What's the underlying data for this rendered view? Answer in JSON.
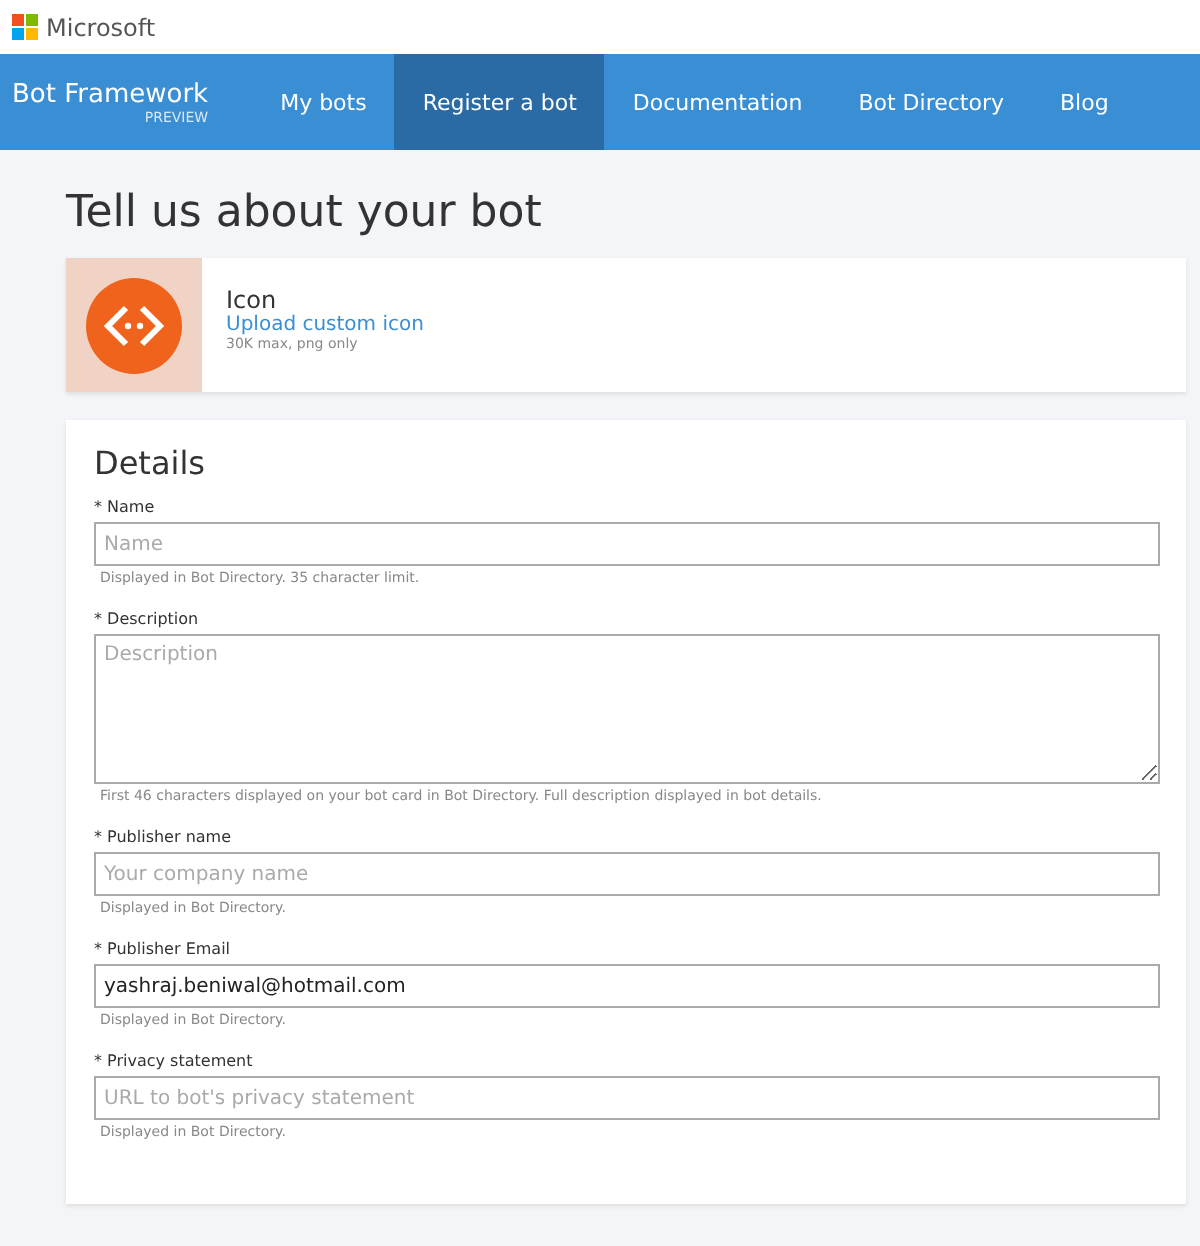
{
  "brand": {
    "name": "Microsoft"
  },
  "nav": {
    "title": "Bot Framework",
    "subtitle": "PREVIEW",
    "items": [
      {
        "label": "My bots",
        "selected": false
      },
      {
        "label": "Register a bot",
        "selected": true
      },
      {
        "label": "Documentation",
        "selected": false
      },
      {
        "label": "Bot Directory",
        "selected": false
      },
      {
        "label": "Blog",
        "selected": false
      }
    ]
  },
  "page_title": "Tell us about your bot",
  "icon_card": {
    "title": "Icon",
    "link": "Upload custom icon",
    "hint": "30K max, png only"
  },
  "details": {
    "title": "Details",
    "fields": [
      {
        "kind": "input",
        "label": "* Name",
        "placeholder": "Name",
        "help": "Displayed in Bot Directory. 35 character limit."
      },
      {
        "kind": "textarea",
        "label": "* Description",
        "placeholder": "Description",
        "help": "First 46 characters displayed on your bot card in Bot Directory. Full description displayed in bot details."
      },
      {
        "kind": "input",
        "label": "* Publisher name",
        "placeholder": "Your company name",
        "help": "Displayed in Bot Directory."
      },
      {
        "kind": "input",
        "label": "* Publisher Email",
        "value": "yashraj.beniwal@hotmail.com",
        "help": "Displayed in Bot Directory."
      },
      {
        "kind": "input",
        "label": "* Privacy statement",
        "placeholder": "URL to bot's privacy statement",
        "help": "Displayed in Bot Directory."
      }
    ]
  }
}
